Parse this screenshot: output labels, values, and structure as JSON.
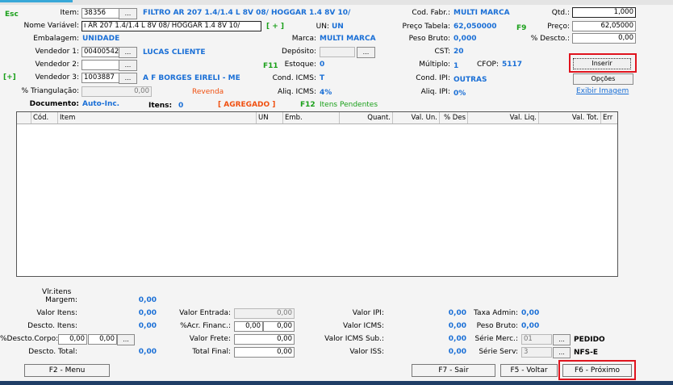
{
  "header": {
    "esc": "Esc",
    "item_label": "Item:",
    "item_code": "38356",
    "item_lookup": "...",
    "item_desc": "FILTRO AR 207 1.4/1.4 L 8V 08/ HOGGAR 1.4 8V 10/",
    "nome_variavel_label": "Nome Variável:",
    "nome_variavel_value": "ı AR 207 1.4/1.4 L 8V 08/ HOGGAR 1.4 8V 10/",
    "plus": "[ + ]",
    "un_label": "UN:",
    "un_value": "UN",
    "embalagem_label": "Embalagem:",
    "embalagem_value": "UNIDADE",
    "marca_label": "Marca:",
    "marca_value": "MULTI MARCA",
    "vendedor1_label": "Vendedor 1:",
    "vendedor1_code": "00400542",
    "vendedor1_lookup": "...",
    "vendedor1_name": "LUCAS CLIENTE",
    "deposito_label": "Depósito:",
    "deposito_lookup": "...",
    "vendedor2_label": "Vendedor 2:",
    "vendedor2_lookup": "...",
    "f11": "F11",
    "estoque_label": "Estoque:",
    "estoque_value": "0",
    "vendedor3_plus": "[+]",
    "vendedor3_label": "Vendedor 3:",
    "vendedor3_code": "1003887",
    "vendedor3_lookup": "...",
    "vendedor3_name": "A F BORGES EIRELI - ME",
    "cond_icms_label": "Cond. ICMS:",
    "cond_icms_value": "T",
    "triangulacao_label": "% Triangulação:",
    "triangulacao_value": "0,00",
    "revenda": "Revenda",
    "aliq_icms_label": "Aliq. ICMS:",
    "aliq_icms_value": "4%",
    "documento_label": "Documento:",
    "documento_value": "Auto-Inc.",
    "itens_label": "Itens:",
    "itens_value": "0",
    "agregado": "[ AGREGADO ]",
    "f12": "F12",
    "itens_pendentes": "Itens Pendentes",
    "cod_fabr_label": "Cod. Fabr.:",
    "cod_fabr_value": "MULTI MARCA",
    "preco_tabela_label": "Preço Tabela:",
    "preco_tabela_value": "62,050000",
    "peso_bruto_label": "Peso Bruto:",
    "peso_bruto_value": "0,000",
    "cst_label": "CST:",
    "cst_value": "20",
    "multiplo_label": "Múltiplo:",
    "multiplo_value": "1",
    "cfop_label": "CFOP:",
    "cfop_value": "5117",
    "cond_ipi_label": "Cond. IPI:",
    "cond_ipi_value": "OUTRAS",
    "aliq_ipi_label": "Aliq. IPI:",
    "aliq_ipi_value": "0%",
    "qtd_label": "Qtd.:",
    "qtd_value": "1,000",
    "f9": "F9",
    "preco_label": "Preço:",
    "preco_value": "62,05000",
    "desconto_label": "% Descto.:",
    "desconto_value": "0,00",
    "inserir": "Inserir",
    "opcoes": "Opções",
    "exibir_imagem": "Exibir Imagem"
  },
  "grid": {
    "columns": [
      "Cód.",
      "Item",
      "UN",
      "Emb.",
      "Quant.",
      "Val. Un.",
      "% Des",
      "Val. Liq.",
      "Val. Tot.",
      "Err"
    ]
  },
  "totals": {
    "vlr_itens_margem_label1": "Vlr.itens",
    "vlr_itens_margem_label2": "Margem:",
    "margem_value": "0,00",
    "valor_itens_label": "Valor Itens:",
    "valor_itens_value": "0,00",
    "descto_itens_label": "Descto. Itens:",
    "descto_itens_value": "0,00",
    "descto_corpo_label": "%Descto.Corpo:",
    "descto_corpo_pct": "0,00",
    "descto_corpo_value": "0,00",
    "descto_corpo_lookup": "...",
    "descto_total_label": "Descto. Total:",
    "descto_total_value": "0,00",
    "valor_entrada_label": "Valor Entrada:",
    "valor_entrada_value": "0,00",
    "acr_financ_label": "%Acr. Financ.:",
    "acr_financ_pct": "0,00",
    "acr_financ_value": "0,00",
    "valor_frete_label": "Valor Frete:",
    "valor_frete_value": "0,00",
    "total_final_label": "Total Final:",
    "total_final_value": "0,00",
    "valor_ipi_label": "Valor IPI:",
    "valor_ipi_value": "0,00",
    "valor_icms_label": "Valor ICMS:",
    "valor_icms_value": "0,00",
    "valor_icms_sub_label": "Valor ICMS Sub.:",
    "valor_icms_sub_value": "0,00",
    "valor_iss_label": "Valor ISS:",
    "valor_iss_value": "0,00",
    "taxa_admin_label": "Taxa Admin:",
    "taxa_admin_value": "0,00",
    "peso_bruto_label": "Peso Bruto:",
    "peso_bruto_value": "0,00",
    "serie_merc_label": "Série Merc.:",
    "serie_merc_value": "01",
    "serie_merc_lookup": "...",
    "pedido": "PEDIDO",
    "serie_serv_label": "Série Serv:",
    "serie_serv_value": "3",
    "serie_serv_lookup": "...",
    "nfse": "NFS-E"
  },
  "footer": {
    "menu": "F2 - Menu",
    "sair": "F7 - Sair",
    "voltar": "F5 - Voltar",
    "proximo": "F6 - Próximo"
  }
}
